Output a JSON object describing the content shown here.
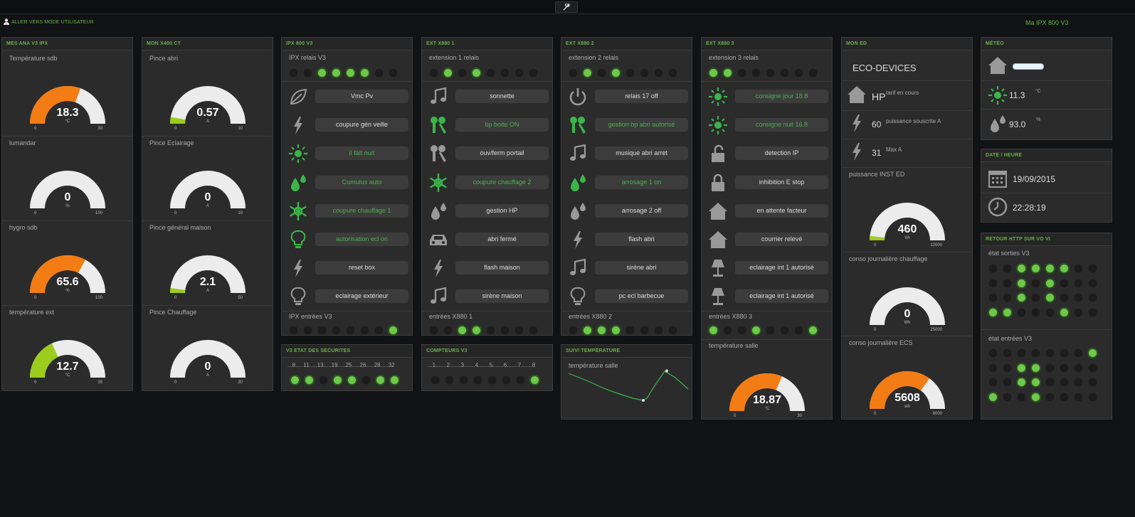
{
  "topbar": {
    "wrench": "🔧",
    "usermode": "ALLER VERS MODE UTILISATEUR",
    "app_title": "Ma IPX 800 V3"
  },
  "panels": {
    "p1": {
      "title": "MES ANA V3 IPX",
      "gauges": [
        {
          "label": "Température sdb",
          "value": "18.3",
          "unit": "°C",
          "min": "0",
          "max": "30",
          "fraction": 0.61,
          "color": "#f47c14"
        },
        {
          "label": "lumandar",
          "value": "0",
          "unit": "%",
          "min": "0",
          "max": "100",
          "fraction": 0,
          "color": "#f47c14"
        },
        {
          "label": "hygro sdb",
          "value": "65.6",
          "unit": "%",
          "min": "0",
          "max": "100",
          "fraction": 0.656,
          "color": "#f47c14"
        },
        {
          "label": "température ext",
          "value": "12.7",
          "unit": "°C",
          "min": "0",
          "max": "35",
          "fraction": 0.363,
          "color": "#9ccc1c"
        }
      ]
    },
    "p2": {
      "title": "MON X400 CT",
      "gauges": [
        {
          "label": "Pince abri",
          "value": "0.57",
          "unit": "A",
          "min": "0",
          "max": "10",
          "fraction": 0.057,
          "color": "#9ccc1c"
        },
        {
          "label": "Pince Eclairage",
          "value": "0",
          "unit": "A",
          "min": "0",
          "max": "10",
          "fraction": 0,
          "color": "#9ccc1c"
        },
        {
          "label": "Pince général maison",
          "value": "2.1",
          "unit": "A",
          "min": "0",
          "max": "50",
          "fraction": 0.042,
          "color": "#9ccc1c"
        },
        {
          "label": "Pince Chauffage",
          "value": "0",
          "unit": "A",
          "min": "0",
          "max": "20",
          "fraction": 0,
          "color": "#9ccc1c"
        }
      ]
    },
    "p3": {
      "title": "IPX 800 V3",
      "relais_label": "IPX relais V3",
      "relais": [
        0,
        0,
        1,
        1,
        1,
        1,
        0,
        0
      ],
      "buttons": [
        {
          "icon": "leaf-icon",
          "label": "Vmc Pv",
          "on": false
        },
        {
          "icon": "lightning-icon",
          "label": "coupure gén veille",
          "on": false
        },
        {
          "icon": "sun-icon",
          "label": "il fait nuit",
          "on": true
        },
        {
          "icon": "drops-icon",
          "label": "Cumulus auto",
          "on": true
        },
        {
          "icon": "snowflake-icon",
          "label": "coupure chauffage 1",
          "on": true
        },
        {
          "icon": "bulb-icon",
          "label": "autorisation ecl on",
          "on": true
        },
        {
          "icon": "lightning-icon",
          "label": "reset box",
          "on": false
        },
        {
          "icon": "bulb-icon",
          "label": "eclairage extérieur",
          "on": false
        }
      ],
      "entrees_label": "IPX entrées V3",
      "entrees": [
        0,
        0,
        0,
        0,
        0,
        0,
        0,
        1
      ]
    },
    "p4": {
      "title": "EXT X880 1",
      "relais_label": "extension 1 relais",
      "relais": [
        0,
        1,
        0,
        1,
        0,
        0,
        0,
        0
      ],
      "buttons": [
        {
          "icon": "music-icon",
          "label": "sonnette",
          "on": false
        },
        {
          "icon": "keys-icon",
          "label": "bp boite ON",
          "on": true
        },
        {
          "icon": "keys-icon",
          "label": "ouv/ferm portail",
          "on": false
        },
        {
          "icon": "snowflake-icon",
          "label": "coupure chauffage 2",
          "on": true
        },
        {
          "icon": "drops-icon",
          "label": "gestion HP",
          "on": false
        },
        {
          "icon": "car-icon",
          "label": "abri fermé",
          "on": false
        },
        {
          "icon": "lightning-icon",
          "label": "flash maison",
          "on": false
        },
        {
          "icon": "music-icon",
          "label": "sirène maison",
          "on": false
        }
      ],
      "entrees_label": "entrées X880 1",
      "entrees": [
        0,
        0,
        1,
        1,
        0,
        0,
        0,
        0
      ]
    },
    "p5": {
      "title": "EXT X880 2",
      "relais_label": "extension 2 relais",
      "relais": [
        0,
        1,
        0,
        1,
        0,
        0,
        0,
        0
      ],
      "buttons": [
        {
          "icon": "power-icon",
          "label": "relais 17 off",
          "on": false
        },
        {
          "icon": "keys-icon",
          "label": "gestion bp abri autorisé",
          "on": true
        },
        {
          "icon": "music-icon",
          "label": "musique abri arret",
          "on": false
        },
        {
          "icon": "drops-icon",
          "label": "arrosage 1 on",
          "on": true
        },
        {
          "icon": "drops-icon",
          "label": "arrosage 2 off",
          "on": false
        },
        {
          "icon": "lightning-icon",
          "label": "flash abri",
          "on": false
        },
        {
          "icon": "music-icon",
          "label": "sirène abri",
          "on": false
        },
        {
          "icon": "bulb-icon",
          "label": "pc ecl barbecue",
          "on": false
        }
      ],
      "entrees_label": "entrées X880 2",
      "entrees": [
        0,
        1,
        1,
        1,
        0,
        0,
        0,
        0
      ]
    },
    "p6": {
      "title": "EXT X880 3",
      "relais_label": "extension 3 relais",
      "relais": [
        1,
        1,
        0,
        0,
        0,
        0,
        0,
        0
      ],
      "buttons": [
        {
          "icon": "sun-icon",
          "label": "consigne jour 18.8",
          "on": true
        },
        {
          "icon": "sun-icon",
          "label": "consigne nuit 16.8",
          "on": true
        },
        {
          "icon": "unlock-icon",
          "label": "detection IP",
          "on": false
        },
        {
          "icon": "lock-icon",
          "label": "inhibition E stop",
          "on": false
        },
        {
          "icon": "home-icon",
          "label": "en attente facteur",
          "on": false
        },
        {
          "icon": "home-icon",
          "label": "courrier relevé",
          "on": false
        },
        {
          "icon": "lamp-icon",
          "label": "eclairage int 1 autorisé",
          "on": false
        },
        {
          "icon": "lamp-icon",
          "label": "eclairage int 1 autorisé",
          "on": false
        }
      ],
      "entrees_label": "entrées X880 3",
      "entrees": [
        1,
        0,
        0,
        1,
        0,
        0,
        0,
        1
      ],
      "gauge": {
        "label": "température salle",
        "value": "18.87",
        "unit": "°C",
        "min": "0",
        "max": "30",
        "fraction": 0.629,
        "color": "#f47c14"
      }
    },
    "p7": {
      "title": "MON ED",
      "eco": "ECO-DEVICES",
      "rows": [
        {
          "icon": "home-icon",
          "value": "HP",
          "text": "tarif en cours"
        },
        {
          "icon": "lightning-icon",
          "value": "60",
          "text": "puissance souscrite A"
        },
        {
          "icon": "lightning-icon",
          "value": "31",
          "text": "Max A"
        }
      ],
      "gauges": [
        {
          "label": "puissance INST ED",
          "value": "460",
          "unit": "VA",
          "min": "0",
          "max": "12000",
          "fraction": 0.038,
          "color": "#9ccc1c"
        },
        {
          "label": "conso journalière chauffage",
          "value": "0",
          "unit": "Wh",
          "min": "0",
          "max": "25000",
          "fraction": 0,
          "color": "#f47c14"
        },
        {
          "label": "conso journalière ECS",
          "value": "5608",
          "unit": "wh",
          "min": "0",
          "max": "8000",
          "fraction": 0.701,
          "color": "#f47c14"
        }
      ]
    },
    "p8": {
      "title": "MÉTÉO",
      "temp": "11.3",
      "temp_unit": "°C",
      "hum": "93.0",
      "hum_unit": "%"
    },
    "p9": {
      "title": "DATE / HEURE",
      "date": "19/09/2015",
      "time": "22:28:19"
    },
    "p10": {
      "title": "RETOUR HTTP SUR VO VI",
      "sorties_label": "état sorties V3",
      "sorties": [
        [
          0,
          0,
          1,
          1,
          1,
          1,
          0,
          0
        ],
        [
          0,
          0,
          1,
          0,
          1,
          0,
          0,
          0
        ],
        [
          0,
          0,
          1,
          0,
          1,
          0,
          0,
          0
        ],
        [
          1,
          1,
          0,
          0,
          0,
          1,
          0,
          0
        ]
      ],
      "entrees_label": "état entrées V3",
      "entrees": [
        [
          0,
          0,
          0,
          0,
          0,
          0,
          0,
          1
        ],
        [
          0,
          0,
          1,
          1,
          0,
          0,
          0,
          0
        ],
        [
          0,
          0,
          1,
          1,
          0,
          0,
          0,
          0
        ],
        [
          1,
          0,
          0,
          1,
          0,
          0,
          0,
          0
        ]
      ]
    },
    "p11": {
      "title": "V3 ETAT DES SECURITES",
      "scale": "...8.....11.....13.....19.....25.....26.....28.....32",
      "leds": [
        1,
        1,
        0,
        1,
        1,
        0,
        1,
        1
      ]
    },
    "p12": {
      "title": "COMPTEURS V3",
      "scale": "...1.......2.......3.......4.......5.......6.......7.......8",
      "leds": [
        0,
        0,
        0,
        0,
        0,
        0,
        0,
        1
      ]
    },
    "p13": {
      "title": "SUIVI TEMPÉRATURE",
      "label": "température salle"
    }
  }
}
